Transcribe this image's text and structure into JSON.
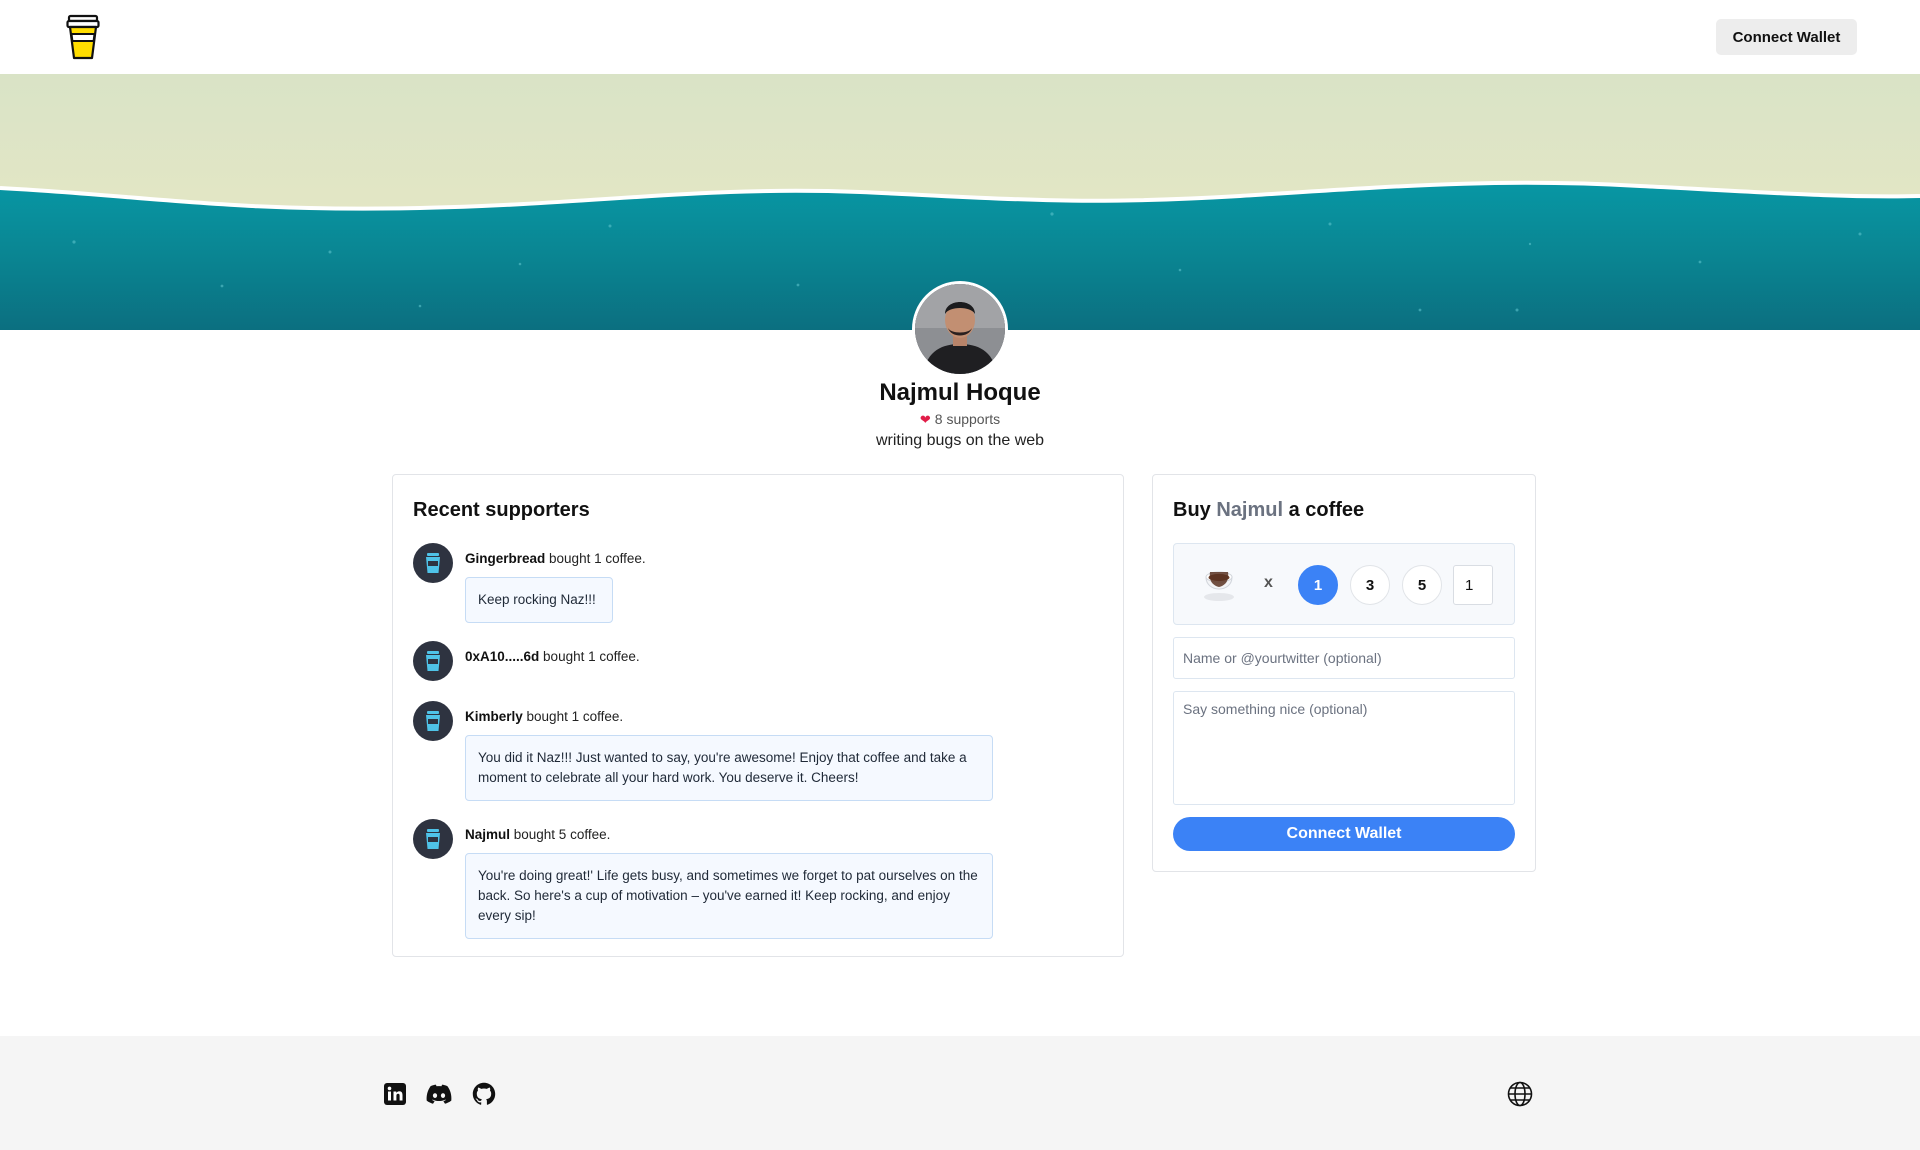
{
  "header": {
    "connect_label": "Connect Wallet",
    "logo_icon": "coffee-cup-logo"
  },
  "colors": {
    "accent": "#3b82f6",
    "sand": "#e4ecc6",
    "sea": "#0a8e9c",
    "heart": "#e11d48"
  },
  "profile": {
    "name": "Najmul Hoque",
    "supports": "8 supports",
    "bio": "writing bugs on the web"
  },
  "supporters": {
    "title": "Recent supporters",
    "items": [
      {
        "name": "Gingerbread",
        "action": " bought 1 coffee.",
        "message": "Keep rocking Naz!!!"
      },
      {
        "name": "0xA10.....6d",
        "action": " bought 1 coffee.",
        "message": ""
      },
      {
        "name": "Kimberly",
        "action": " bought 1 coffee.",
        "message": "You did it Naz!!! Just wanted to say, you're awesome! Enjoy that coffee and take a moment to celebrate all your hard work. You deserve it. Cheers!"
      },
      {
        "name": "Najmul",
        "action": " bought 5 coffee.",
        "message": "You're doing great!' Life gets busy, and sometimes we forget to pat ourselves on the back. So here's a cup of motivation – you've earned it! Keep rocking, and enjoy every sip!"
      }
    ]
  },
  "buy": {
    "title_prefix": "Buy ",
    "title_name": "Najmul",
    "title_suffix": " a coffee",
    "multiplier": "x",
    "options": [
      "1",
      "3",
      "5"
    ],
    "selected": "1",
    "quantity": "1",
    "name_placeholder": "Name or @yourtwitter (optional)",
    "message_placeholder": "Say something nice (optional)",
    "button_label": "Connect Wallet"
  },
  "footer": {
    "icons": [
      "linkedin-icon",
      "discord-icon",
      "github-icon"
    ],
    "language_icon": "globe-icon"
  }
}
